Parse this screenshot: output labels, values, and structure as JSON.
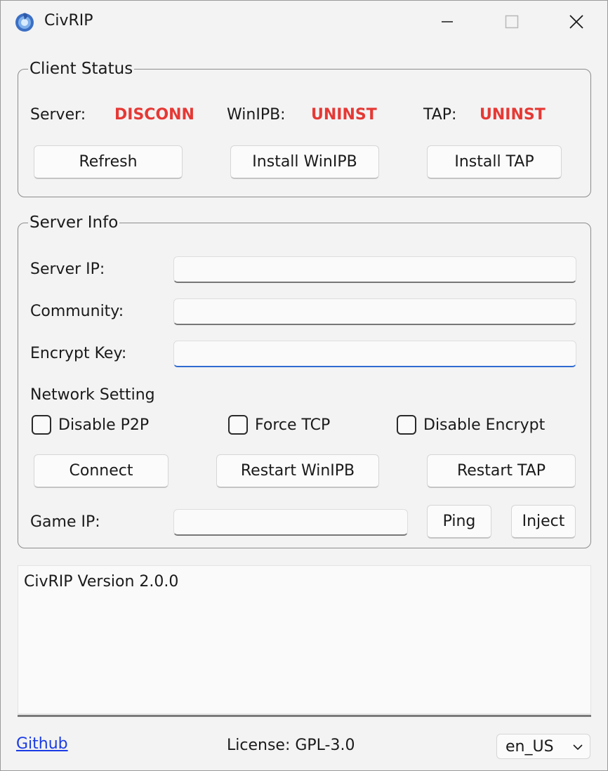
{
  "window": {
    "title": "CivRIP"
  },
  "client_status": {
    "legend": "Client Status",
    "server_label": "Server:",
    "server_value": "DISCONN",
    "winipb_label": "WinIPB:",
    "winipb_value": "UNINST",
    "tap_label": "TAP:",
    "tap_value": "UNINST",
    "refresh_label": "Refresh",
    "install_winipb_label": "Install WinIPB",
    "install_tap_label": "Install TAP",
    "status_color": "#e53935"
  },
  "server_info": {
    "legend": "Server Info",
    "server_ip_label": "Server IP:",
    "server_ip_value": "",
    "community_label": "Community:",
    "community_value": "",
    "encrypt_key_label": "Encrypt Key:",
    "encrypt_key_value": "",
    "network_setting_label": "Network Setting",
    "disable_p2p_label": "Disable P2P",
    "force_tcp_label": "Force TCP",
    "disable_encrypt_label": "Disable Encrypt",
    "connect_label": "Connect",
    "restart_winipb_label": "Restart WinIPB",
    "restart_tap_label": "Restart TAP",
    "game_ip_label": "Game IP:",
    "game_ip_value": "",
    "ping_label": "Ping",
    "inject_label": "Inject"
  },
  "log": {
    "text": "CivRIP Version 2.0.0"
  },
  "footer": {
    "github_link": "Github",
    "license": "License: GPL-3.0",
    "language_selected": "en_US"
  },
  "icons": [
    "app-icon",
    "minimize-icon",
    "maximize-icon",
    "close-icon",
    "chevron-down-icon"
  ]
}
